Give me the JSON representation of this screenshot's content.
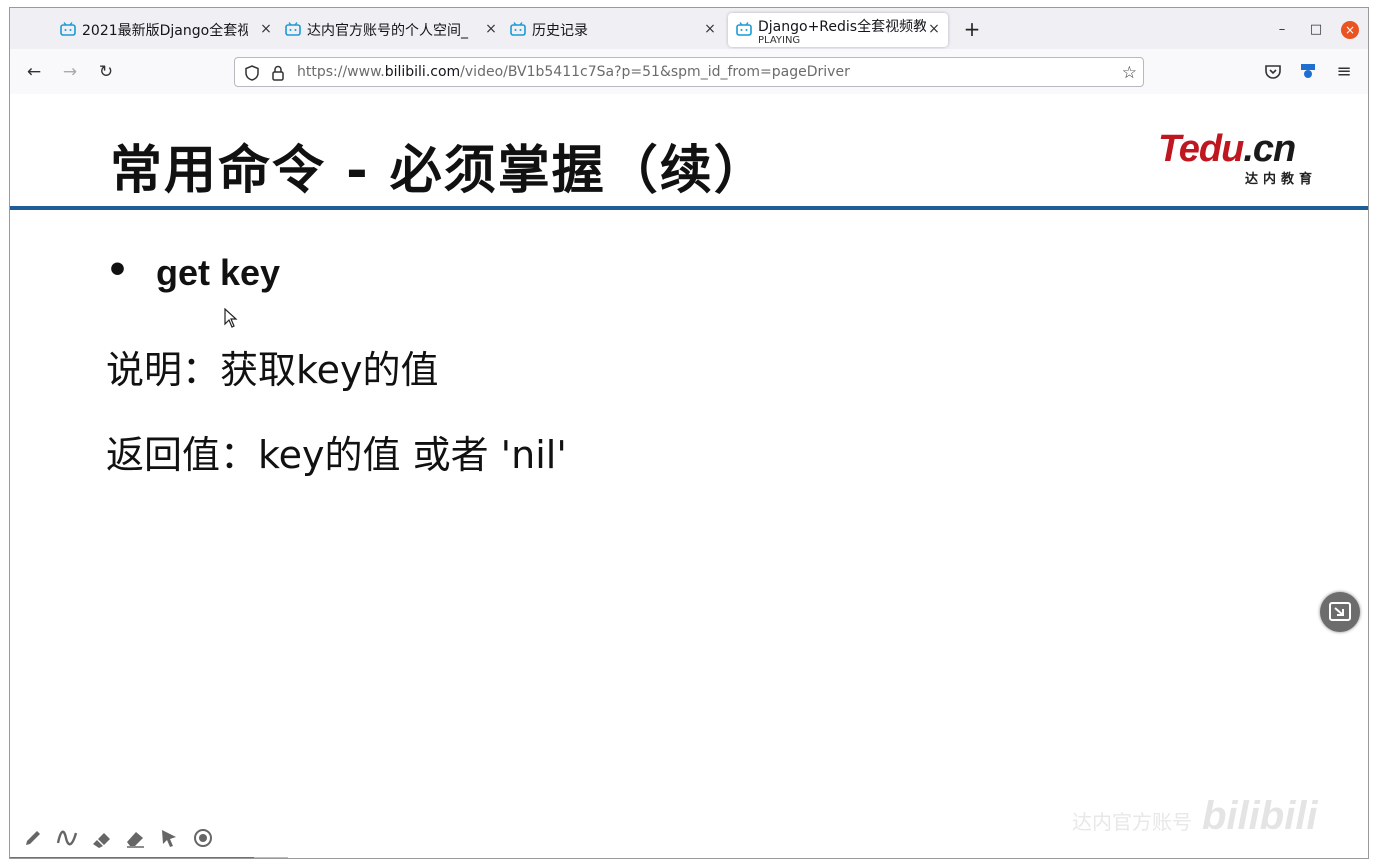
{
  "tabs": [
    {
      "title": "2021最新版Django全套视",
      "close": "×"
    },
    {
      "title": "达内官方账号的个人空间_",
      "close": "×"
    },
    {
      "title": "历史记录",
      "close": "×"
    },
    {
      "title": "Django+Redis全套视频教",
      "subtitle": "PLAYING",
      "close": "×",
      "active": true
    }
  ],
  "window_controls": {
    "new_tab": "+",
    "minimize": "–",
    "maximize": "□",
    "close": "×"
  },
  "nav": {
    "back": "←",
    "forward": "→",
    "reload": "↻",
    "url_prefix": "https://www.",
    "url_domain": "bilibili.com",
    "url_path": "/video/BV1b5411c7Sa?p=51&spm_id_from=pageDriver",
    "bookmark": "☆",
    "pocket": "⛉",
    "extension": "◆",
    "menu": "≡"
  },
  "slide": {
    "title": "常用命令 - 必须掌握（续）",
    "logo_main": "Tedu",
    "logo_dot": ".cn",
    "logo_sub": "达内教育",
    "bullet": "•",
    "item_title": "get key",
    "desc_line": "说明：获取key的值",
    "return_line": "返回值：key的值 或者 'nil'"
  },
  "watermark": {
    "text": "达内官方账号",
    "brand": "bilibili"
  },
  "accent": "#1f5d97",
  "tools": [
    "pencil-icon",
    "wave-icon",
    "marker-icon",
    "eraser-icon",
    "pointer-icon",
    "record-icon"
  ]
}
